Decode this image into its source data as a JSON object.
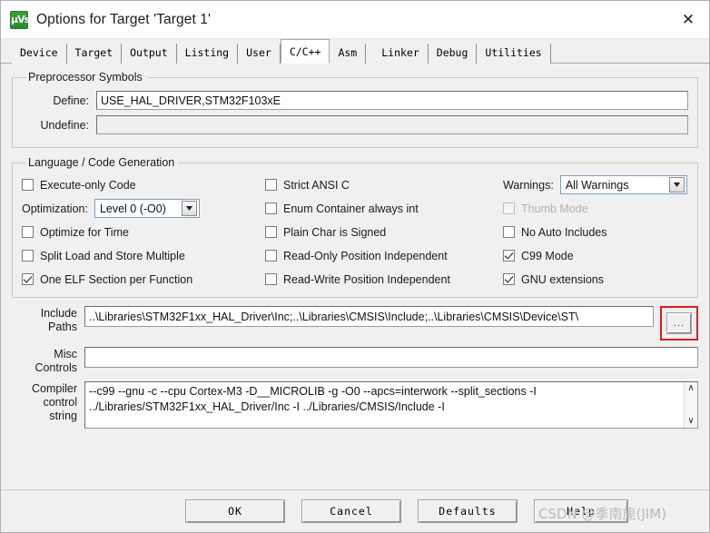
{
  "window": {
    "title": "Options for Target 'Target 1'",
    "icon": "keil-uvision-icon",
    "icon_glyph": "μVs",
    "close_glyph": "✕"
  },
  "tabs": [
    {
      "label": "Device",
      "active": false
    },
    {
      "label": "Target",
      "active": false
    },
    {
      "label": "Output",
      "active": false
    },
    {
      "label": "Listing",
      "active": false
    },
    {
      "label": "User",
      "active": false
    },
    {
      "label": "C/C++",
      "active": true
    },
    {
      "label": "Asm",
      "active": false
    },
    {
      "label": "Linker",
      "active": false
    },
    {
      "label": "Debug",
      "active": false
    },
    {
      "label": "Utilities",
      "active": false
    }
  ],
  "preprocessor": {
    "legend": "Preprocessor Symbols",
    "define_label": "Define:",
    "define_value": "USE_HAL_DRIVER,STM32F103xE",
    "undefine_label": "Undefine:",
    "undefine_value": "",
    "undefine_placeholder": ""
  },
  "language": {
    "legend": "Language / Code Generation",
    "col1": [
      {
        "label": "Execute-only Code",
        "checked": false,
        "disabled": false
      },
      {
        "label": "Optimize for Time",
        "checked": false,
        "disabled": false
      },
      {
        "label": "Split Load and Store Multiple",
        "checked": false,
        "disabled": false
      },
      {
        "label": "One ELF Section per Function",
        "checked": true,
        "disabled": false
      }
    ],
    "optimization_label": "Optimization:",
    "optimization_value": "Level 0 (-O0)",
    "col2": [
      {
        "label": "Strict ANSI C",
        "checked": false,
        "disabled": false
      },
      {
        "label": "Enum Container always int",
        "checked": false,
        "disabled": false
      },
      {
        "label": "Plain Char is Signed",
        "checked": false,
        "disabled": false
      },
      {
        "label": "Read-Only Position Independent",
        "checked": false,
        "disabled": false
      },
      {
        "label": "Read-Write Position Independent",
        "checked": false,
        "disabled": false
      }
    ],
    "warnings_label": "Warnings:",
    "warnings_value": "All Warnings",
    "col3": [
      {
        "label": "Thumb Mode",
        "checked": false,
        "disabled": true
      },
      {
        "label": "No Auto Includes",
        "checked": false,
        "disabled": false
      },
      {
        "label": "C99 Mode",
        "checked": true,
        "disabled": false
      },
      {
        "label": "GNU extensions",
        "checked": true,
        "disabled": false
      }
    ]
  },
  "paths": {
    "include_label_line1": "Include",
    "include_label_line2": "Paths",
    "include_value": "..\\Libraries\\STM32F1xx_HAL_Driver\\Inc;..\\Libraries\\CMSIS\\Include;..\\Libraries\\CMSIS\\Device\\ST\\",
    "browse_label": "...",
    "misc_label_line1": "Misc",
    "misc_label_line2": "Controls",
    "misc_value": ""
  },
  "compiler": {
    "label_line1": "Compiler",
    "label_line2": "control",
    "label_line3": "string",
    "line1": "--c99 --gnu -c --cpu Cortex-M3 -D__MICROLIB -g -O0 --apcs=interwork --split_sections -I",
    "line2": "../Libraries/STM32F1xx_HAL_Driver/Inc -I ../Libraries/CMSIS/Include -I",
    "scroll_up": "∧",
    "scroll_down": "∨"
  },
  "footer": {
    "ok": "OK",
    "cancel": "Cancel",
    "defaults": "Defaults",
    "help": "Help"
  },
  "watermark": {
    "text": "CSDN @季南旎(JIM)"
  },
  "colors": {
    "highlight": "#e01b1b",
    "dialog_bg": "#f0f0f0",
    "field_bg": "#ffffff"
  }
}
